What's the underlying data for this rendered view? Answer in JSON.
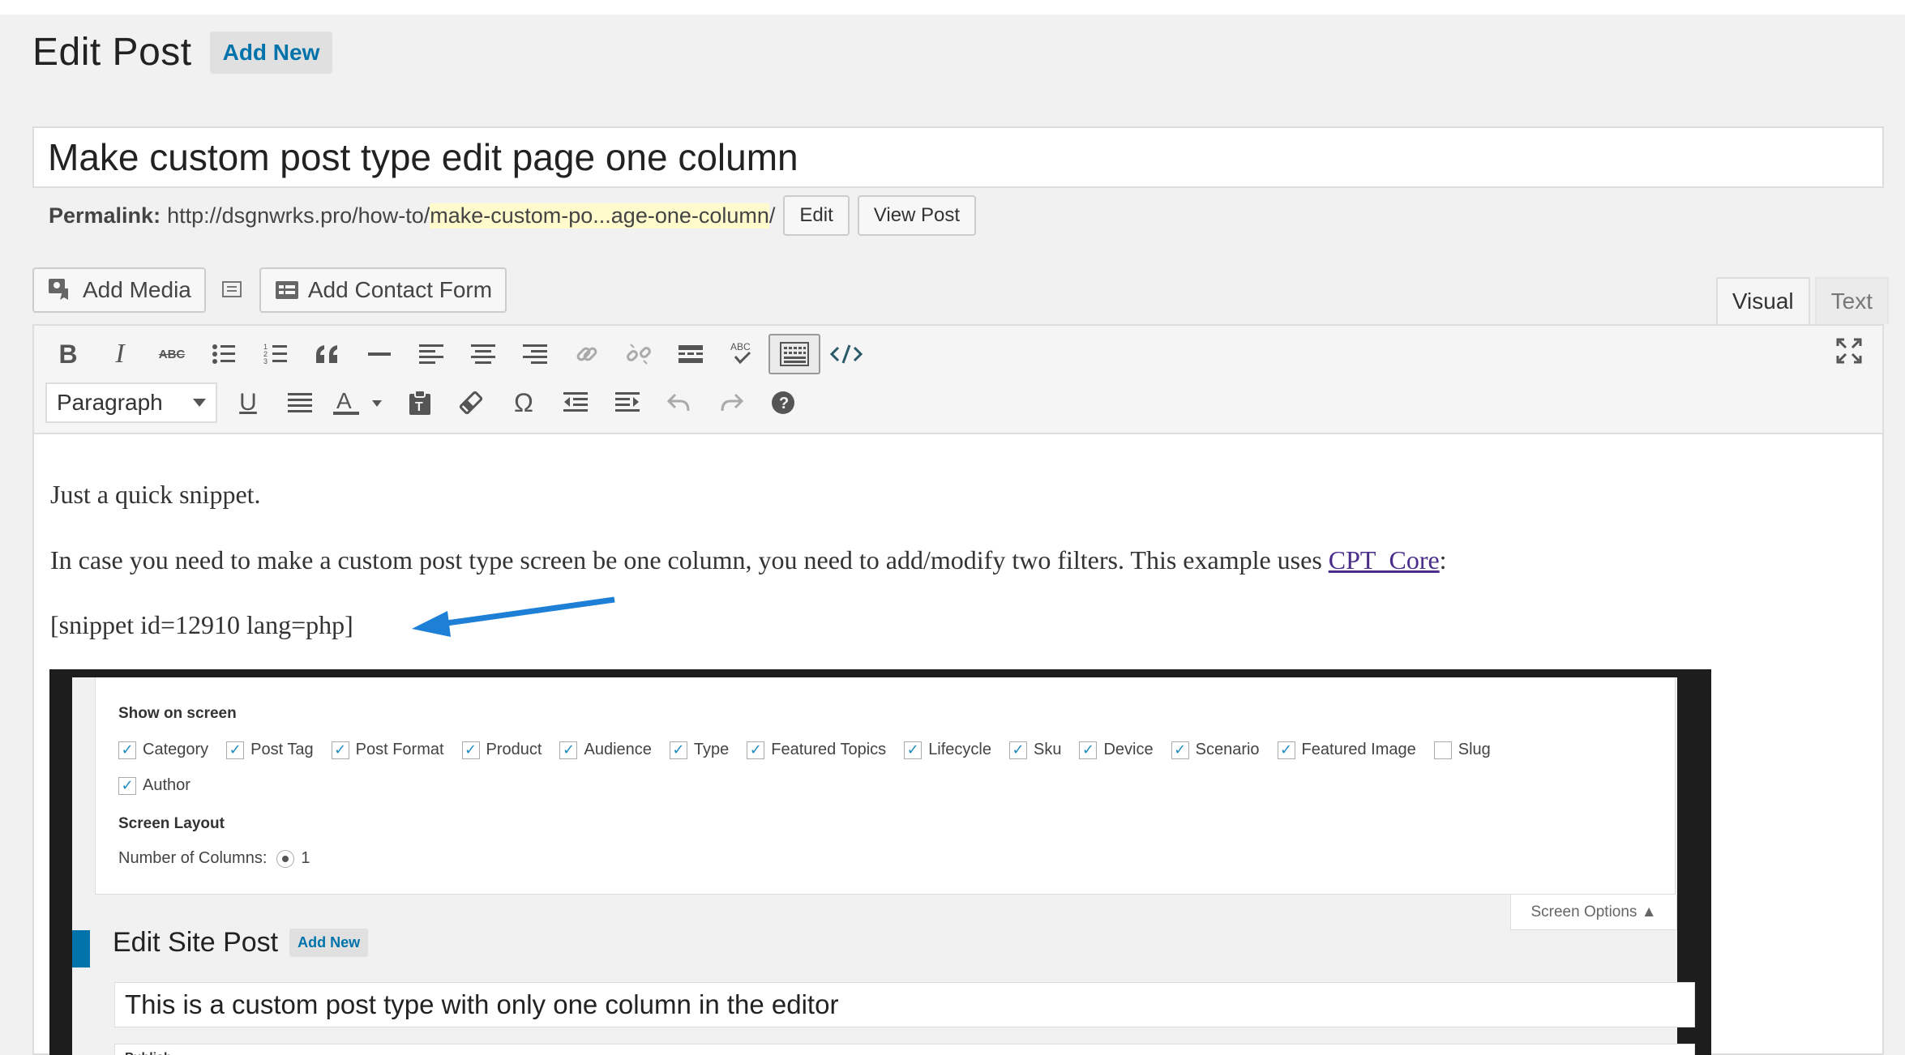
{
  "header": {
    "title": "Edit Post",
    "add_new": "Add New"
  },
  "post": {
    "title": "Make custom post type edit page one column"
  },
  "permalink": {
    "label": "Permalink:",
    "base": "http://dsgnwrks.pro/how-to/",
    "slug": "make-custom-po...age-one-column",
    "trail": "/",
    "edit_label": "Edit",
    "view_label": "View Post"
  },
  "media": {
    "add_media": "Add Media",
    "add_contact_form": "Add Contact Form"
  },
  "tabs": {
    "visual": "Visual",
    "text": "Text"
  },
  "toolbar": {
    "row1": [
      "bold-icon",
      "italic-icon",
      "strikethrough-icon",
      "bullet-list-icon",
      "numbered-list-icon",
      "blockquote-icon",
      "horizontal-line-icon",
      "align-left-icon",
      "align-center-icon",
      "align-right-icon",
      "insert-link-icon",
      "remove-link-icon",
      "read-more-icon",
      "spellcheck-icon",
      "toolbar-toggle-icon",
      "code-icon"
    ],
    "format_value": "Paragraph",
    "row2": [
      "underline-icon",
      "justify-icon",
      "text-color-icon",
      "paste-text-icon",
      "clear-format-icon",
      "special-char-icon",
      "outdent-icon",
      "indent-icon",
      "undo-icon",
      "redo-icon",
      "help-icon"
    ],
    "bold_glyph": "B",
    "italic_glyph": "I",
    "abc_glyph": "ABC",
    "underline_glyph": "U",
    "text_color_glyph": "A",
    "omega_glyph": "Ω",
    "help_glyph": "?"
  },
  "content": {
    "p1": "Just a quick snippet.",
    "p2_before": "In case you need to make a custom post type screen be one column, you need to add/modify two filters. This example uses ",
    "p2_link": "CPT_Core",
    "p2_after": ":",
    "snippet": "[snippet id=12910 lang=php]"
  },
  "screenshot": {
    "show_on_screen": "Show on screen",
    "checkboxes": [
      {
        "label": "Category",
        "checked": true
      },
      {
        "label": "Post Tag",
        "checked": true
      },
      {
        "label": "Post Format",
        "checked": true
      },
      {
        "label": "Product",
        "checked": true
      },
      {
        "label": "Audience",
        "checked": true
      },
      {
        "label": "Type",
        "checked": true
      },
      {
        "label": "Featured Topics",
        "checked": true
      },
      {
        "label": "Lifecycle",
        "checked": true
      },
      {
        "label": "Sku",
        "checked": true
      },
      {
        "label": "Device",
        "checked": true
      },
      {
        "label": "Scenario",
        "checked": true
      },
      {
        "label": "Featured Image",
        "checked": true
      },
      {
        "label": "Slug",
        "checked": false
      }
    ],
    "author": {
      "label": "Author",
      "checked": true
    },
    "screen_layout": "Screen Layout",
    "columns_label": "Number of Columns:",
    "columns_value": "1",
    "screen_options": "Screen Options ▲",
    "edit_title": "Edit Site Post",
    "add_new": "Add New",
    "post_title": "This is a custom post type with only one column in the editor",
    "publish": "Publish"
  },
  "colors": {
    "accent": "#0073aa",
    "arrow": "#1e7fd6",
    "highlight": "#fffbcc",
    "link": "#4b2d8a"
  }
}
